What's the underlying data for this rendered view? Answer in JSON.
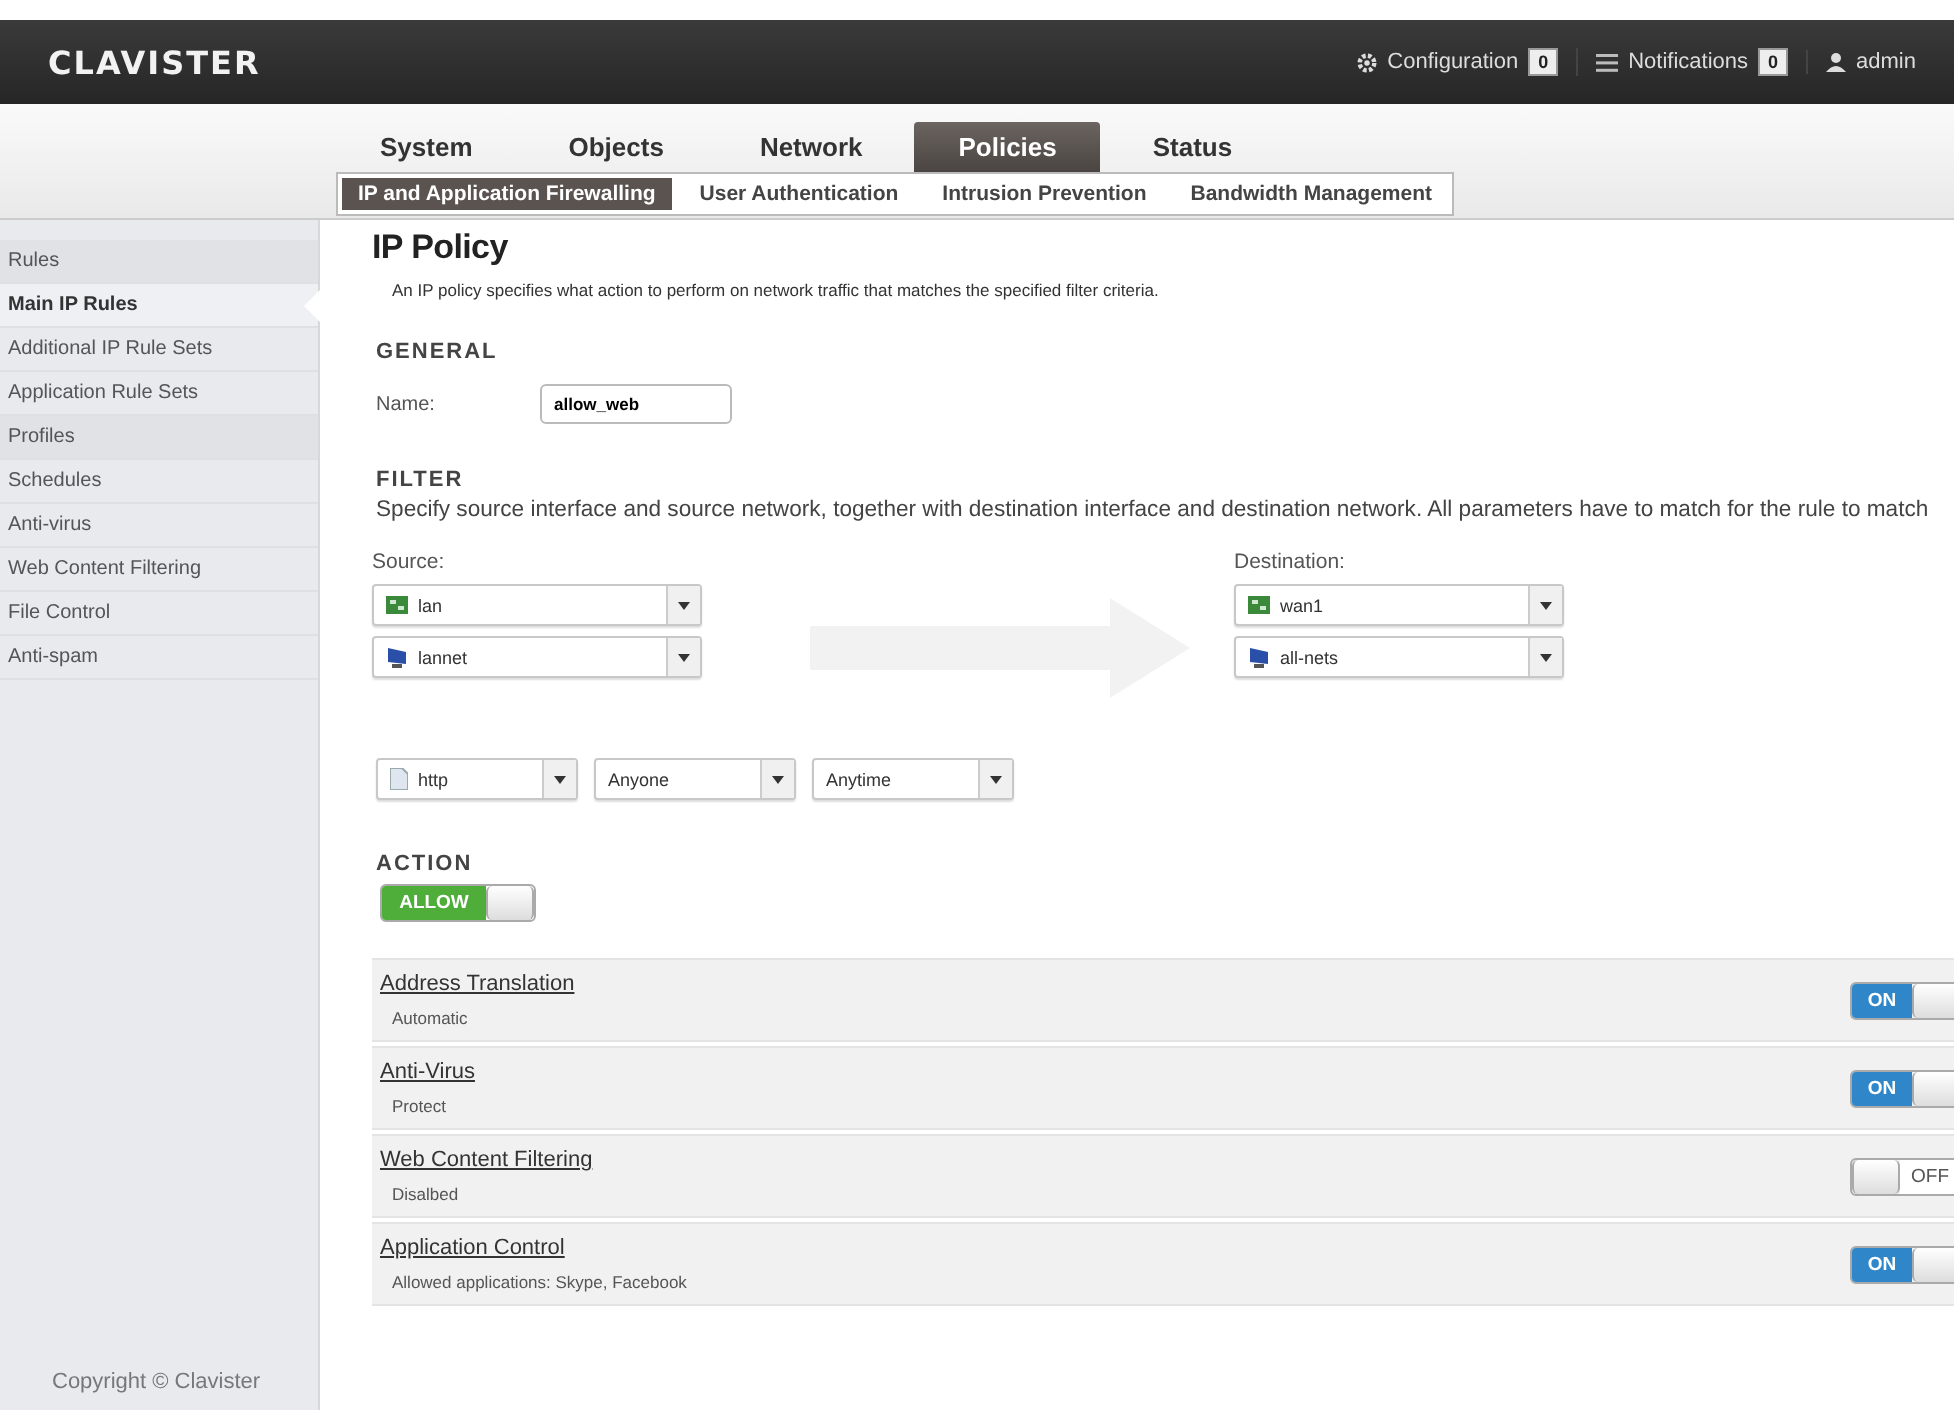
{
  "header": {
    "logo": "CLAVISTER",
    "configuration": {
      "label": "Configuration",
      "count": "0"
    },
    "notifications": {
      "label": "Notifications",
      "count": "0"
    },
    "user": "admin"
  },
  "main_tabs": [
    {
      "label": "System",
      "selected": false
    },
    {
      "label": "Objects",
      "selected": false
    },
    {
      "label": "Network",
      "selected": false
    },
    {
      "label": "Policies",
      "selected": true
    },
    {
      "label": "Status",
      "selected": false
    }
  ],
  "sub_tabs": [
    {
      "label": "IP and Application Firewalling",
      "selected": true
    },
    {
      "label": "User Authentication",
      "selected": false
    },
    {
      "label": "Intrusion Prevention",
      "selected": false
    },
    {
      "label": "Bandwidth Management",
      "selected": false
    }
  ],
  "sidebar": {
    "items": [
      {
        "label": "Rules",
        "kind": "header",
        "selected": false
      },
      {
        "label": "Main IP Rules",
        "kind": "item",
        "selected": true
      },
      {
        "label": "Additional IP Rule Sets",
        "kind": "item",
        "selected": false
      },
      {
        "label": "Application Rule Sets",
        "kind": "item",
        "selected": false
      },
      {
        "label": "Profiles",
        "kind": "header",
        "selected": false
      },
      {
        "label": "Schedules",
        "kind": "item",
        "selected": false
      },
      {
        "label": "Anti-virus",
        "kind": "item",
        "selected": false
      },
      {
        "label": "Web Content Filtering",
        "kind": "item",
        "selected": false
      },
      {
        "label": "File Control",
        "kind": "item",
        "selected": false
      },
      {
        "label": "Anti-spam",
        "kind": "item",
        "selected": false
      }
    ],
    "copyright": "Copyright © Clavister"
  },
  "page": {
    "title": "IP Policy",
    "description": "An IP policy specifies what action to perform on network traffic that matches the specified filter criteria.",
    "general": {
      "heading": "GENERAL",
      "name_label": "Name:",
      "name_value": "allow_web"
    },
    "filter": {
      "heading": "FILTER",
      "description": "Specify source interface and source network, together with destination interface and destination network. All parameters have to match for the rule to match",
      "source": {
        "label": "Source:",
        "selects": [
          {
            "kind": "interface",
            "value": "lan"
          },
          {
            "kind": "network",
            "value": "lannet"
          }
        ]
      },
      "destination": {
        "label": "Destination:",
        "selects": [
          {
            "kind": "interface",
            "value": "wan1"
          },
          {
            "kind": "network",
            "value": "all-nets"
          }
        ]
      },
      "extra": [
        {
          "kind": "service",
          "value": "http"
        },
        {
          "kind": "plain",
          "value": "Anyone"
        },
        {
          "kind": "plain",
          "value": "Anytime"
        }
      ]
    },
    "action": {
      "heading": "ACTION",
      "label": "ALLOW",
      "on": true
    },
    "features": [
      {
        "title": "Address Translation",
        "detail": "Automatic",
        "on": true,
        "switch_label": "ON"
      },
      {
        "title": "Anti-Virus",
        "detail": "Protect",
        "on": true,
        "switch_label": "ON"
      },
      {
        "title": "Web Content Filtering",
        "detail": "Disalbed",
        "on": false,
        "switch_label": "OFF"
      },
      {
        "title": "Application Control",
        "detail": "Allowed applications: Skype, Facebook",
        "on": true,
        "switch_label": "ON"
      }
    ]
  }
}
